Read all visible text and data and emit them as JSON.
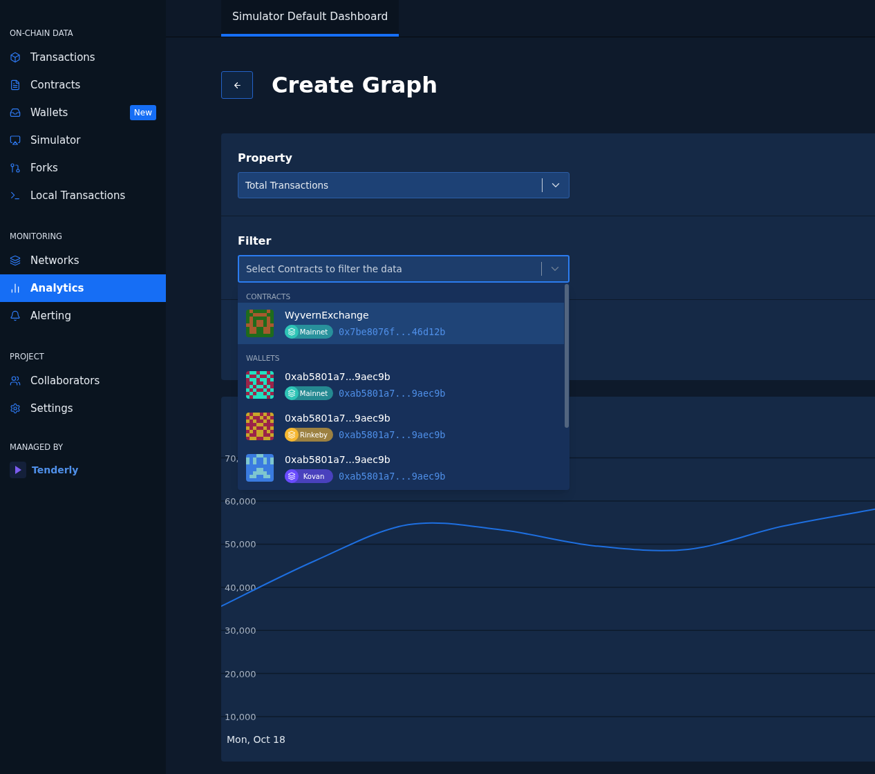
{
  "sidebar": {
    "sections": [
      {
        "title": "ON-CHAIN DATA",
        "items": [
          {
            "label": "Transactions",
            "selected": false
          },
          {
            "label": "Contracts",
            "selected": false
          },
          {
            "label": "Wallets",
            "selected": false,
            "badge": "New"
          },
          {
            "label": "Simulator",
            "selected": false
          },
          {
            "label": "Forks",
            "selected": false
          },
          {
            "label": "Local Transactions",
            "selected": false
          }
        ]
      },
      {
        "title": "MONITORING",
        "items": [
          {
            "label": "Networks",
            "selected": false
          },
          {
            "label": "Analytics",
            "selected": true
          },
          {
            "label": "Alerting",
            "selected": false
          }
        ]
      },
      {
        "title": "PROJECT",
        "items": [
          {
            "label": "Collaborators",
            "selected": false
          },
          {
            "label": "Settings",
            "selected": false
          }
        ]
      }
    ],
    "managed_by": {
      "title": "MANAGED BY",
      "name": "Tenderly"
    }
  },
  "tabs": [
    {
      "label": "Simulator Default Dashboard",
      "selected": true
    }
  ],
  "page_title": "Create Graph",
  "property": {
    "label": "Property",
    "value": "Total Transactions"
  },
  "filter": {
    "label": "Filter",
    "placeholder": "Select Contracts to filter the data",
    "focused": true
  },
  "dropdown": {
    "groups": [
      {
        "title": "CONTRACTS",
        "options": [
          {
            "name": "WyvernExchange",
            "network": "Mainnet",
            "color": "#2ec4b6",
            "address": "0x7be8076f...46d12b",
            "selected": true
          }
        ]
      },
      {
        "title": "WALLETS",
        "options": [
          {
            "name": "0xab5801a7...9aec9b",
            "network": "Mainnet",
            "color": "#2ec4b6",
            "address": "0xab5801a7...9aec9b",
            "selected": false
          },
          {
            "name": "0xab5801a7...9aec9b",
            "network": "Rinkeby",
            "color": "#f5b731",
            "address": "0xab5801a7...9aec9b",
            "selected": false
          },
          {
            "name": "0xab5801a7...9aec9b",
            "network": "Kovan",
            "color": "#6a4cff",
            "address": "0xab5801a7...9aec9b",
            "selected": false
          }
        ]
      }
    ]
  },
  "chart": {
    "top_label": "70,",
    "date_label": "Mon, Oct 18",
    "chart_data": {
      "type": "line",
      "grid": true,
      "ylim": [
        -417,
        84199
      ],
      "yticks": [
        {
          "value": 10000,
          "label": "10,000"
        },
        {
          "value": 20000,
          "label": "20,000"
        },
        {
          "value": 30000,
          "label": "30,000"
        },
        {
          "value": 40000,
          "label": "40,000"
        },
        {
          "value": 50000,
          "label": "50,000"
        },
        {
          "value": 60000,
          "label": "60,000"
        }
      ],
      "series": [
        {
          "color": "#1e6fe0",
          "values": [
            35600,
            46100,
            54500,
            53300,
            49600,
            48800,
            54100,
            58100
          ]
        }
      ]
    }
  }
}
